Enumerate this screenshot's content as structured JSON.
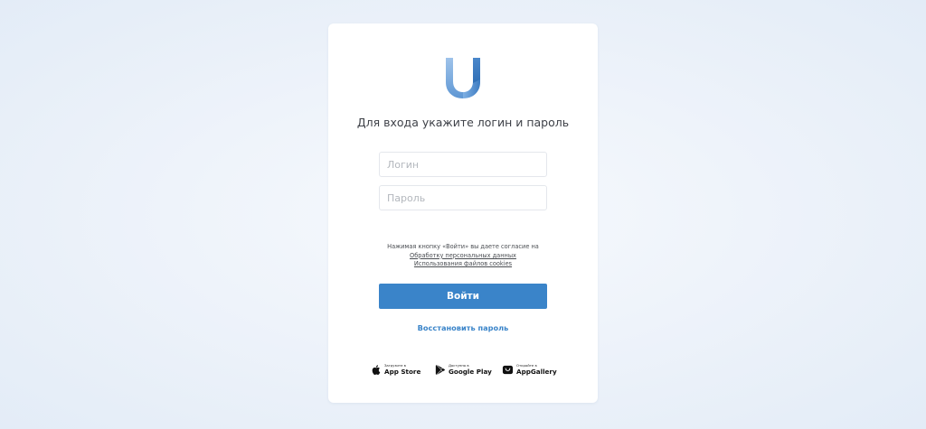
{
  "colors": {
    "accent": "#3a84c9",
    "background": "#eef3fa",
    "card": "#ffffff",
    "text": "#3e4148"
  },
  "logo": {
    "icon": "u-logo-icon"
  },
  "login": {
    "heading": "Для входа укажите логин и пароль",
    "login_placeholder": "Логин",
    "password_placeholder": "Пароль",
    "consent_text": "Нажимая кнопку «Войти» вы даете согласие на",
    "consent_link_data": "Обработку персональных данных",
    "consent_link_cookies": "Использования файлов cookies",
    "submit_label": "Войти",
    "restore_label": "Восстановить пароль"
  },
  "stores": [
    {
      "icon": "apple-icon",
      "sub": "Загрузите в",
      "name": "App Store"
    },
    {
      "icon": "google-play-icon",
      "sub": "Доступно в",
      "name": "Google Play"
    },
    {
      "icon": "huawei-appgallery-icon",
      "sub": "Откройте в",
      "name": "AppGallery"
    }
  ]
}
